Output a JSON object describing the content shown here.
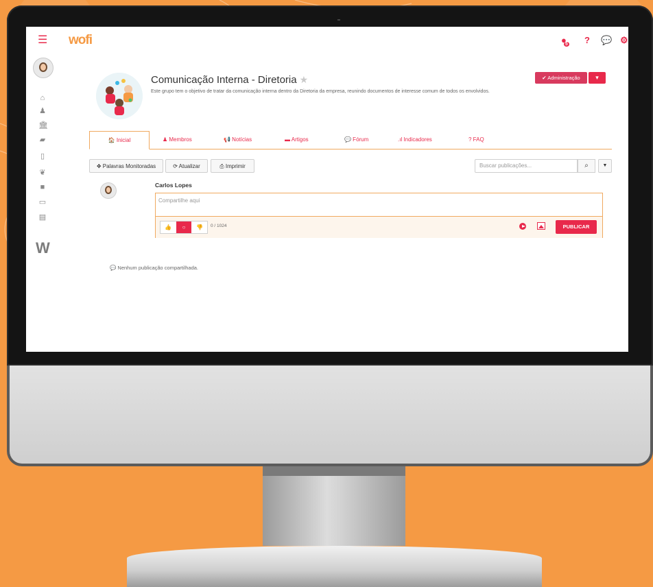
{
  "app": {
    "logo": "wofi",
    "top_icons": [
      "globe-icon",
      "help-icon",
      "chat-icon",
      "settings-icon"
    ],
    "notification_count": "5"
  },
  "sidebar": {
    "items": [
      {
        "icon": "home-icon"
      },
      {
        "icon": "user-icon"
      },
      {
        "icon": "institution-icon"
      },
      {
        "icon": "dashboard-icon"
      },
      {
        "icon": "document-icon"
      },
      {
        "icon": "leaf-icon"
      },
      {
        "icon": "video-icon"
      },
      {
        "icon": "calendar-icon"
      },
      {
        "icon": "file-icon"
      }
    ]
  },
  "group": {
    "title": "Comunicação Interna - Diretoria",
    "description": "Este grupo tem o objetivo de tratar da comunicação interna dentro da Diretoria da empresa, reunindo documentos de interesse comum de todos os envolvidos.",
    "admin_label": "✔ Administração"
  },
  "tabs": [
    {
      "label": "🏠 Inicial"
    },
    {
      "label": "♟ Membros"
    },
    {
      "label": "📢 Notícias"
    },
    {
      "label": "▬ Artigos"
    },
    {
      "label": "💬 Fórum"
    },
    {
      "label": ".ıl Indicadores"
    },
    {
      "label": "? FAQ"
    }
  ],
  "toolbar": {
    "keywords_label": "✥ Palavras Monitoradas",
    "refresh_label": "⟳ Atualizar",
    "print_label": "⎙ Imprimir",
    "search_placeholder": "Buscar publicações..."
  },
  "post": {
    "author": "Carlos Lopes",
    "placeholder": "Compartilhe aqui",
    "counter": "0 / 1024",
    "publish_label": "PUBLICAR"
  },
  "feed": {
    "empty_message": "💬 Nenhum publicação compartilhada."
  },
  "colors": {
    "brand": "#e8294b",
    "accent": "#f59a44",
    "admin": "#d83a5e"
  }
}
